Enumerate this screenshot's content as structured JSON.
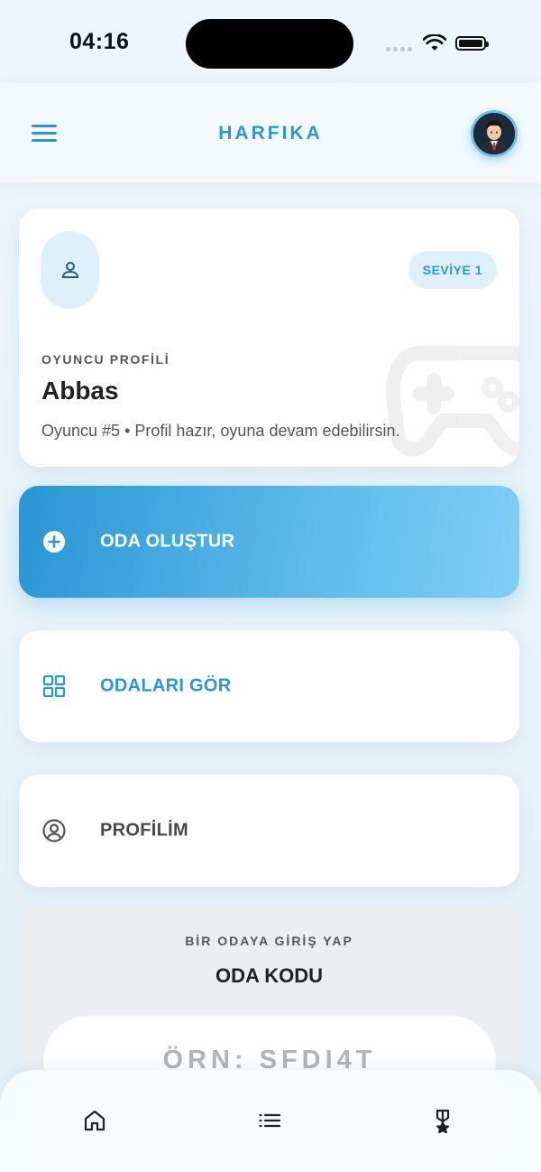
{
  "status_bar": {
    "time": "04:16"
  },
  "header": {
    "title": "HARFIKA"
  },
  "icons": {
    "menu": "hamburger-icon",
    "avatar": "user-avatar",
    "person": "person-icon",
    "gamepad": "gamepad-icon",
    "plus": "plus-circle-icon",
    "grid": "grid-icon",
    "profile": "user-circle-icon",
    "home": "home-icon",
    "list": "list-icon",
    "award": "award-icon"
  },
  "profile_card": {
    "level": "SEVİYE 1",
    "label": "OYUNCU PROFİLİ",
    "name": "Abbas",
    "subtitle": "Oyuncu #5 • Profil hazır, oyuna devam edebilirsin."
  },
  "actions": {
    "create_room": "ODA OLUŞTUR",
    "view_rooms": "ODALARI GÖR",
    "my_profile": "PROFİLİM"
  },
  "join": {
    "subtitle": "BİR ODAYA GİRİŞ YAP",
    "title": "ODA KODU",
    "placeholder": "ÖRN: SFDI4T"
  },
  "colors": {
    "accent": "#2e96d6",
    "gradient_start": "#2a95d5",
    "gradient_end": "#80cff5"
  }
}
